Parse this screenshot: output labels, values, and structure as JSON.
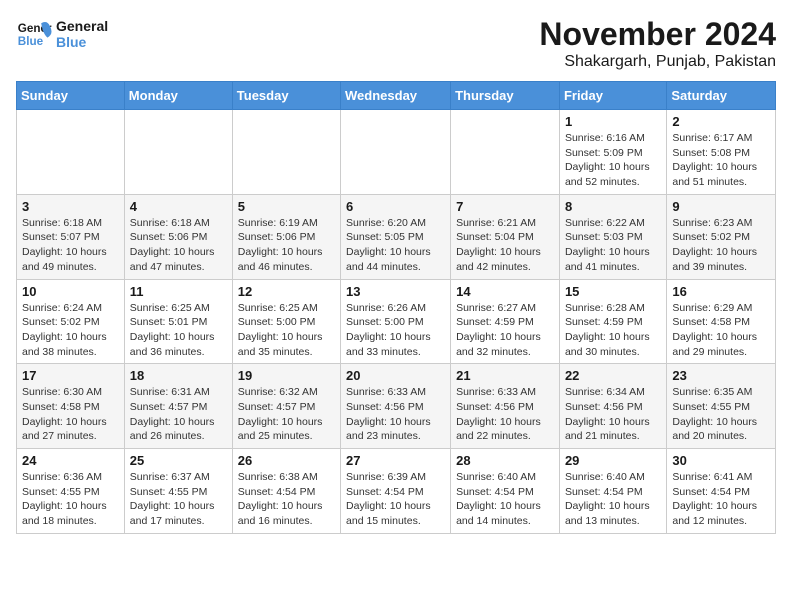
{
  "logo": {
    "line1": "General",
    "line2": "Blue"
  },
  "title": "November 2024",
  "location": "Shakargarh, Punjab, Pakistan",
  "header": {
    "days": [
      "Sunday",
      "Monday",
      "Tuesday",
      "Wednesday",
      "Thursday",
      "Friday",
      "Saturday"
    ]
  },
  "weeks": [
    [
      {
        "day": "",
        "info": ""
      },
      {
        "day": "",
        "info": ""
      },
      {
        "day": "",
        "info": ""
      },
      {
        "day": "",
        "info": ""
      },
      {
        "day": "",
        "info": ""
      },
      {
        "day": "1",
        "info": "Sunrise: 6:16 AM\nSunset: 5:09 PM\nDaylight: 10 hours\nand 52 minutes."
      },
      {
        "day": "2",
        "info": "Sunrise: 6:17 AM\nSunset: 5:08 PM\nDaylight: 10 hours\nand 51 minutes."
      }
    ],
    [
      {
        "day": "3",
        "info": "Sunrise: 6:18 AM\nSunset: 5:07 PM\nDaylight: 10 hours\nand 49 minutes."
      },
      {
        "day": "4",
        "info": "Sunrise: 6:18 AM\nSunset: 5:06 PM\nDaylight: 10 hours\nand 47 minutes."
      },
      {
        "day": "5",
        "info": "Sunrise: 6:19 AM\nSunset: 5:06 PM\nDaylight: 10 hours\nand 46 minutes."
      },
      {
        "day": "6",
        "info": "Sunrise: 6:20 AM\nSunset: 5:05 PM\nDaylight: 10 hours\nand 44 minutes."
      },
      {
        "day": "7",
        "info": "Sunrise: 6:21 AM\nSunset: 5:04 PM\nDaylight: 10 hours\nand 42 minutes."
      },
      {
        "day": "8",
        "info": "Sunrise: 6:22 AM\nSunset: 5:03 PM\nDaylight: 10 hours\nand 41 minutes."
      },
      {
        "day": "9",
        "info": "Sunrise: 6:23 AM\nSunset: 5:02 PM\nDaylight: 10 hours\nand 39 minutes."
      }
    ],
    [
      {
        "day": "10",
        "info": "Sunrise: 6:24 AM\nSunset: 5:02 PM\nDaylight: 10 hours\nand 38 minutes."
      },
      {
        "day": "11",
        "info": "Sunrise: 6:25 AM\nSunset: 5:01 PM\nDaylight: 10 hours\nand 36 minutes."
      },
      {
        "day": "12",
        "info": "Sunrise: 6:25 AM\nSunset: 5:00 PM\nDaylight: 10 hours\nand 35 minutes."
      },
      {
        "day": "13",
        "info": "Sunrise: 6:26 AM\nSunset: 5:00 PM\nDaylight: 10 hours\nand 33 minutes."
      },
      {
        "day": "14",
        "info": "Sunrise: 6:27 AM\nSunset: 4:59 PM\nDaylight: 10 hours\nand 32 minutes."
      },
      {
        "day": "15",
        "info": "Sunrise: 6:28 AM\nSunset: 4:59 PM\nDaylight: 10 hours\nand 30 minutes."
      },
      {
        "day": "16",
        "info": "Sunrise: 6:29 AM\nSunset: 4:58 PM\nDaylight: 10 hours\nand 29 minutes."
      }
    ],
    [
      {
        "day": "17",
        "info": "Sunrise: 6:30 AM\nSunset: 4:58 PM\nDaylight: 10 hours\nand 27 minutes."
      },
      {
        "day": "18",
        "info": "Sunrise: 6:31 AM\nSunset: 4:57 PM\nDaylight: 10 hours\nand 26 minutes."
      },
      {
        "day": "19",
        "info": "Sunrise: 6:32 AM\nSunset: 4:57 PM\nDaylight: 10 hours\nand 25 minutes."
      },
      {
        "day": "20",
        "info": "Sunrise: 6:33 AM\nSunset: 4:56 PM\nDaylight: 10 hours\nand 23 minutes."
      },
      {
        "day": "21",
        "info": "Sunrise: 6:33 AM\nSunset: 4:56 PM\nDaylight: 10 hours\nand 22 minutes."
      },
      {
        "day": "22",
        "info": "Sunrise: 6:34 AM\nSunset: 4:56 PM\nDaylight: 10 hours\nand 21 minutes."
      },
      {
        "day": "23",
        "info": "Sunrise: 6:35 AM\nSunset: 4:55 PM\nDaylight: 10 hours\nand 20 minutes."
      }
    ],
    [
      {
        "day": "24",
        "info": "Sunrise: 6:36 AM\nSunset: 4:55 PM\nDaylight: 10 hours\nand 18 minutes."
      },
      {
        "day": "25",
        "info": "Sunrise: 6:37 AM\nSunset: 4:55 PM\nDaylight: 10 hours\nand 17 minutes."
      },
      {
        "day": "26",
        "info": "Sunrise: 6:38 AM\nSunset: 4:54 PM\nDaylight: 10 hours\nand 16 minutes."
      },
      {
        "day": "27",
        "info": "Sunrise: 6:39 AM\nSunset: 4:54 PM\nDaylight: 10 hours\nand 15 minutes."
      },
      {
        "day": "28",
        "info": "Sunrise: 6:40 AM\nSunset: 4:54 PM\nDaylight: 10 hours\nand 14 minutes."
      },
      {
        "day": "29",
        "info": "Sunrise: 6:40 AM\nSunset: 4:54 PM\nDaylight: 10 hours\nand 13 minutes."
      },
      {
        "day": "30",
        "info": "Sunrise: 6:41 AM\nSunset: 4:54 PM\nDaylight: 10 hours\nand 12 minutes."
      }
    ]
  ]
}
